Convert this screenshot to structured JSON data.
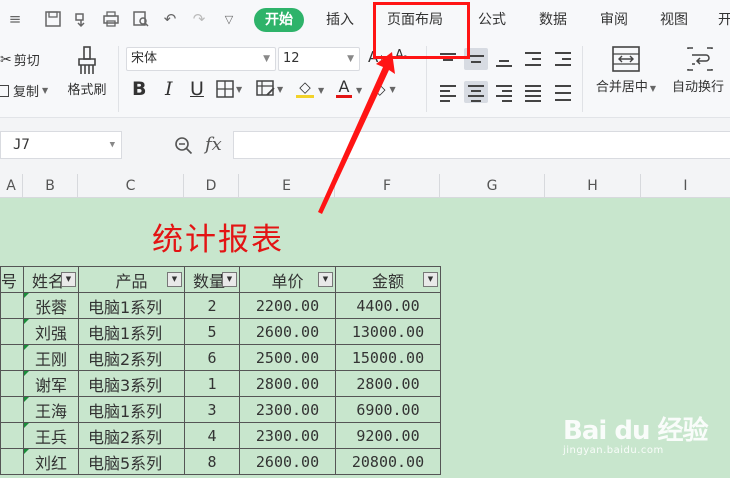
{
  "tabs": {
    "start": "开始",
    "insert": "插入",
    "page_layout": "页面布局",
    "formula": "公式",
    "data": "数据",
    "review": "审阅",
    "view": "视图",
    "more": "开"
  },
  "ribbon": {
    "cut": "剪切",
    "copy": "复制",
    "format_painter": "格式刷",
    "font_name": "宋体",
    "font_size": "12",
    "bold": "B",
    "italic": "I",
    "underline": "U",
    "merge_center": "合并居中",
    "wrap_text": "自动换行"
  },
  "formula_bar": {
    "cell_ref": "J7",
    "fx": "fx",
    "formula": ""
  },
  "columns": [
    "A",
    "B",
    "C",
    "D",
    "E",
    "F",
    "G",
    "H",
    "I"
  ],
  "sheet": {
    "title": "统计报表",
    "headers": [
      "号",
      "姓名",
      "产品",
      "数量",
      "单价",
      "金额"
    ],
    "rows": [
      {
        "name": "张蓉",
        "product": "电脑1系列",
        "qty": "2",
        "price": "2200.00",
        "amount": "4400.00"
      },
      {
        "name": "刘强",
        "product": "电脑1系列",
        "qty": "5",
        "price": "2600.00",
        "amount": "13000.00"
      },
      {
        "name": "王刚",
        "product": "电脑2系列",
        "qty": "6",
        "price": "2500.00",
        "amount": "15000.00"
      },
      {
        "name": "谢军",
        "product": "电脑3系列",
        "qty": "1",
        "price": "2800.00",
        "amount": "2800.00"
      },
      {
        "name": "王海",
        "product": "电脑1系列",
        "qty": "3",
        "price": "2300.00",
        "amount": "6900.00"
      },
      {
        "name": "王兵",
        "product": "电脑2系列",
        "qty": "4",
        "price": "2300.00",
        "amount": "9200.00"
      },
      {
        "name": "刘红",
        "product": "电脑5系列",
        "qty": "8",
        "price": "2600.00",
        "amount": "20800.00"
      }
    ]
  },
  "watermark": {
    "brand": "Bai du 经验",
    "url": "jingyan.baidu.com"
  },
  "colors": {
    "accent_green": "#2eb36a",
    "sheet_bg": "#c8e6cd",
    "annotation_red": "#ff1414",
    "title_red": "#e31414"
  }
}
